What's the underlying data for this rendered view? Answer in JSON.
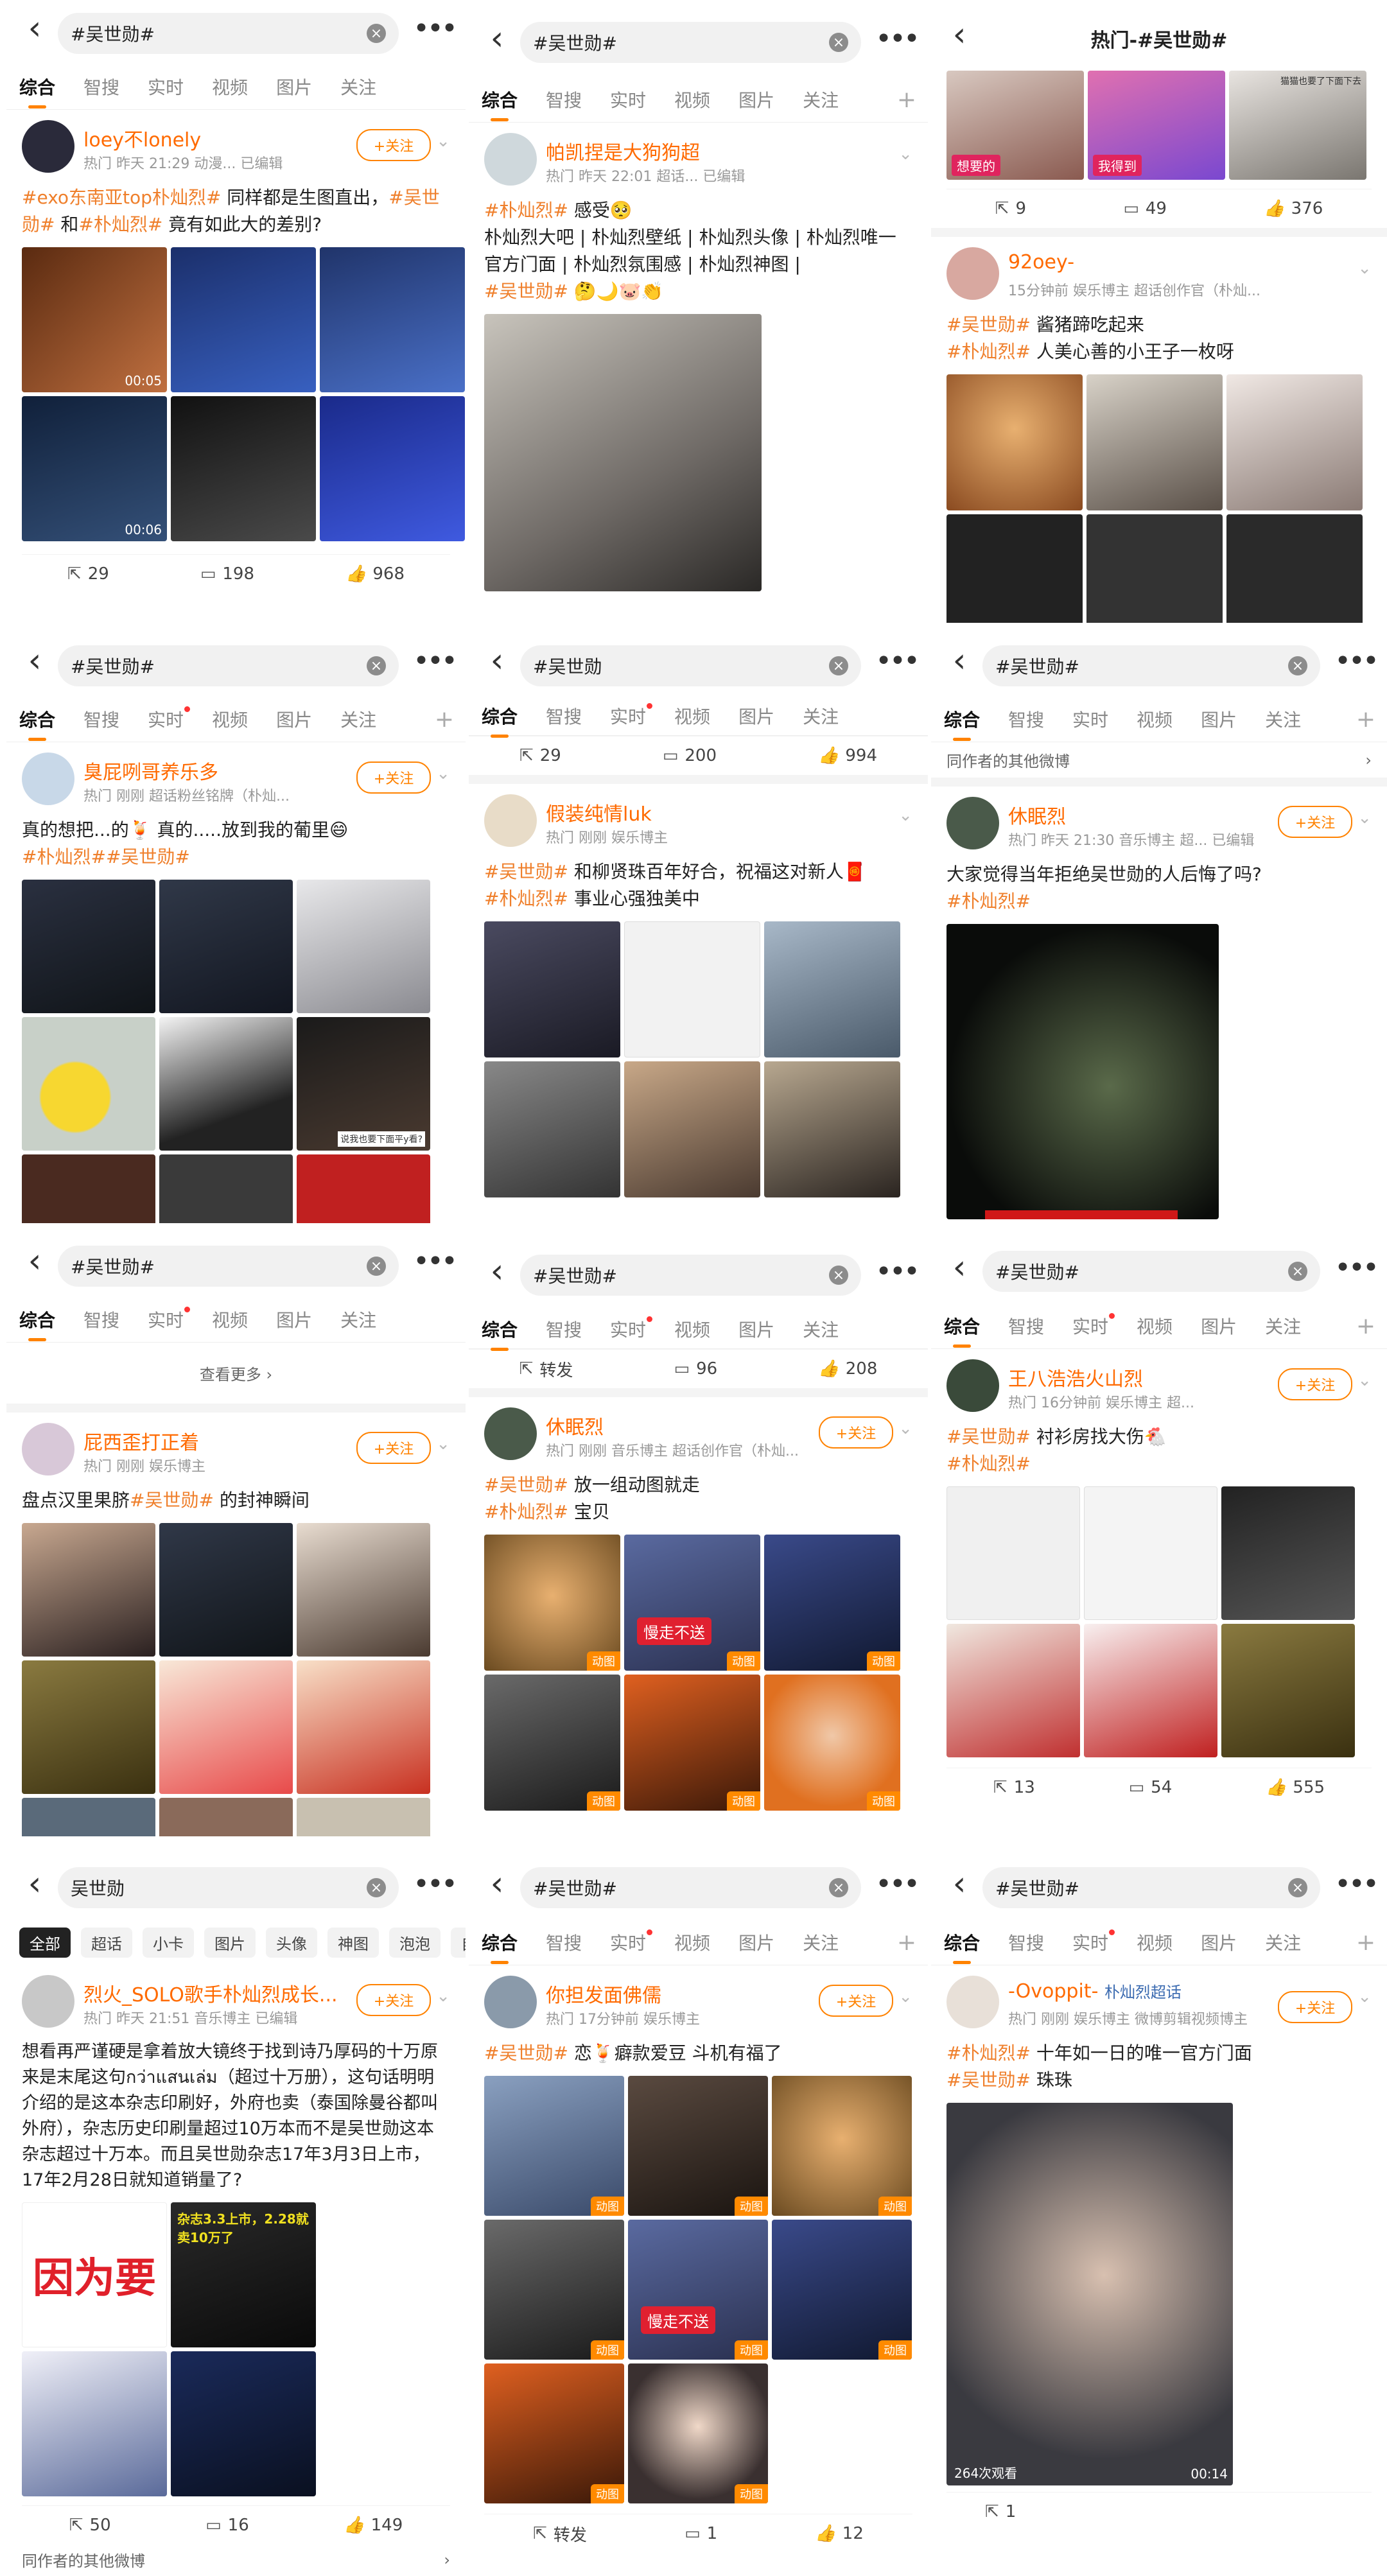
{
  "tabs_std": [
    "综合",
    "智搜",
    "实时",
    "视频",
    "图片",
    "关注"
  ],
  "p1": {
    "query": "#吴世勋#",
    "user": "loey不lonely",
    "meta": "热门  昨天 21:29  动漫...  已编辑",
    "follow": "+关注",
    "text_tag1": "#exo东南亚top朴灿烈#",
    "text_mid": " 同样都是生图直出，",
    "text_tag2": "#吴世勋#",
    "text_and": " 和",
    "text_tag3": "#朴灿烈#",
    "text_end": " 竟有如此大的差别?",
    "durations": [
      "00:05",
      "00:06"
    ],
    "repost": "29",
    "comment": "198",
    "like": "968"
  },
  "p2": {
    "query": "#吴世勋#",
    "user": "帕凯捏是大狗狗超",
    "meta": "热门  昨天 22:01  超话...  已编辑",
    "line1_tag": "#朴灿烈#",
    "line1_text": " 感受🥺",
    "line2": "朴灿烈大吧 | 朴灿烈壁纸 | 朴灿烈头像 | 朴灿烈唯一官方门面 | 朴灿烈氛围感 | 朴灿烈神图 |",
    "line3_tag": "#吴世勋#",
    "line3_text": " 🤔🌙🐷👏"
  },
  "p3": {
    "title": "热门-#吴世勋#",
    "top_labels": [
      "想要的",
      "我得到",
      "猫猫也要了下面下去"
    ],
    "top_repost": "9",
    "top_comment": "49",
    "top_like": "376",
    "user": "92oey-",
    "meta": "15分钟前  娱乐博主  超话创作官（朴灿...",
    "line1_tag": "#吴世勋#",
    "line1_text": " 酱猪蹄吃起来",
    "line2_tag": "#朴灿烈#",
    "line2_text": " 人美心善的小王子一枚呀"
  },
  "p4": {
    "query": "#吴世勋#",
    "user": "臭屁咧哥养乐多",
    "meta": "热门  刚刚  超话粉丝铭牌（朴灿...",
    "text": "真的想把...的🍹 真的.....放到我的葡里😄",
    "tag1": "#朴灿烈#",
    "tag2": "#吴世勋#",
    "img_caption": "说我也要下面平y看?"
  },
  "p5": {
    "query": "#吴世勋",
    "top_repost": "29",
    "top_comment": "200",
    "top_like": "994",
    "user": "假装纯情luk",
    "meta": "热门  刚刚  娱乐博主",
    "line1_tag": "#吴世勋#",
    "line1_text": " 和柳贤珠百年好合，祝福这对新人🧧",
    "line2_tag": "#朴灿烈#",
    "line2_text": " 事业心强独美中"
  },
  "p6": {
    "query": "#吴世勋#",
    "other": "同作者的其他微博",
    "user": "休眠烈",
    "meta": "热门  昨天 21:30  音乐博主  超...  已编辑",
    "text": "大家觉得当年拒绝吴世勋的人后悔了吗?",
    "tag": "#朴灿烈#"
  },
  "p7": {
    "query": "#吴世勋#",
    "see_more": "查看更多 ›",
    "user": "屁西歪打正着",
    "meta": "热门  刚刚  娱乐博主",
    "text_pre": "盘点汉里果脐",
    "tag": "#吴世勋#",
    "text_post": " 的封神瞬间"
  },
  "p8": {
    "query": "#吴世勋#",
    "top_repost": "转发",
    "top_comment": "96",
    "top_like": "208",
    "user": "休眠烈",
    "meta": "热门  刚刚  音乐博主  超话创作官（朴灿...",
    "line1_tag": "#吴世勋#",
    "line1_text": " 放一组动图就走",
    "line2_tag": "#朴灿烈#",
    "line2_text": " 宝贝",
    "sticker": "慢走不送",
    "badge": "动图"
  },
  "p9": {
    "query": "#吴世勋#",
    "user": "王八浩浩火山烈",
    "meta": "热门  16分钟前  娱乐博主  超...",
    "line1_tag": "#吴世勋#",
    "line1_text": " 衬衫房找大伤🐔",
    "line2_tag": "#朴灿烈#",
    "repost": "13",
    "comment": "54",
    "like": "555"
  },
  "p10": {
    "query": "吴世勋",
    "pills": [
      "全部",
      "超话",
      "小卡",
      "图片",
      "头像",
      "神图",
      "泡泡",
      "自拍"
    ],
    "user": "烈火_SOLO歌手朴灿烈成长...",
    "meta": "热门  昨天 21:51  音乐博主  已编辑",
    "text": "想看再严谨硬是拿着放大镜终于找到诗乃厚码的十万原来是末尾这句กว่าแสนเล่ม（超过十万册），这句话明明介绍的是这本杂志印刷好，外府也卖（泰国除曼谷都叫外府），杂志历史印刷量超过10万本而不是吴世勋这本杂志超过十万本。而且吴世勋杂志17年3月3日上市，17年2月28日就知道销量了?",
    "img_big": "因为要",
    "img_small": "杂志3.3上市，2.28就卖10万了",
    "repost": "50",
    "comment": "16",
    "like": "149",
    "footer": "同作者的其他微博"
  },
  "p11": {
    "query": "#吴世勋#",
    "user": "你担发面佛儒",
    "meta": "热门  17分钟前  娱乐博主",
    "tag1": "#吴世勋#",
    "text1": " 恋🍹癖款爱豆 斗机有福了",
    "sticker": "慢走不送",
    "badge": "动图",
    "repost": "转发",
    "comment": "1",
    "like": "12"
  },
  "p12": {
    "query": "#吴世勋#",
    "user": "-Ovoppit-",
    "user_extra": "朴灿烈超话",
    "meta": "热门  刚刚  娱乐博主  微博剪辑视频博主",
    "tag1": "#朴灿烈#",
    "text1": " 十年如一日的唯一官方门面",
    "tag2": "#吴世勋#",
    "text2": " 珠珠",
    "views": "264次观看",
    "duration": "00:14",
    "repost": "1"
  }
}
